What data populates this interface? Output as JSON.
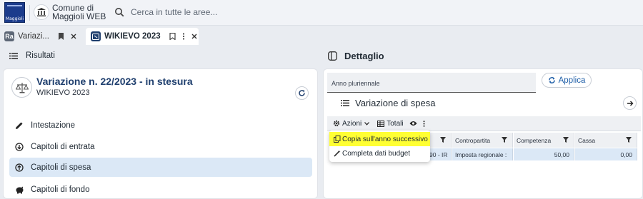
{
  "topbar": {
    "logo_text": "Maggioli",
    "town_name": "Comune di Maggioli WEB",
    "search_placeholder": "Cerca in tutte le aree..."
  },
  "tabs": [
    {
      "badge": "Ra",
      "label": "Variazi..."
    },
    {
      "badge": "W",
      "label": "WIKIEVO 2023"
    }
  ],
  "left": {
    "header_title": "Risultati",
    "card_title": "Variazione n. 22/2023 - in stesura",
    "card_subtitle": "WIKIEVO 2023",
    "menu": [
      {
        "label": "Intestazione",
        "icon": "pencil-icon"
      },
      {
        "label": "Capitoli di entrata",
        "icon": "arrow-down-circle-icon"
      },
      {
        "label": "Capitoli di spesa",
        "icon": "arrow-up-circle-icon"
      },
      {
        "label": "Capitoli di fondo",
        "icon": "piggy-bank-icon"
      }
    ]
  },
  "right": {
    "header_title": "Dettaglio",
    "field_label": "Anno pluriennale",
    "applica_label": "Applica",
    "section_title": "Variazione di spesa",
    "toolbar": {
      "azioni": "Azioni",
      "totali": "Totali"
    },
    "columns": [
      "Contropartita",
      "Competenza",
      "Cassa"
    ],
    "row": {
      "first_partial": "90 - IR",
      "contropartita": "Imposta regionale :",
      "competenza": "50,00",
      "cassa": "0,00"
    },
    "dropdown": [
      "Copia sull'anno successivo",
      "Completa dati budget"
    ]
  },
  "colors": {
    "accent": "#1f3f6e",
    "highlight": "#ffff33",
    "active_row": "#dbe8f6"
  }
}
